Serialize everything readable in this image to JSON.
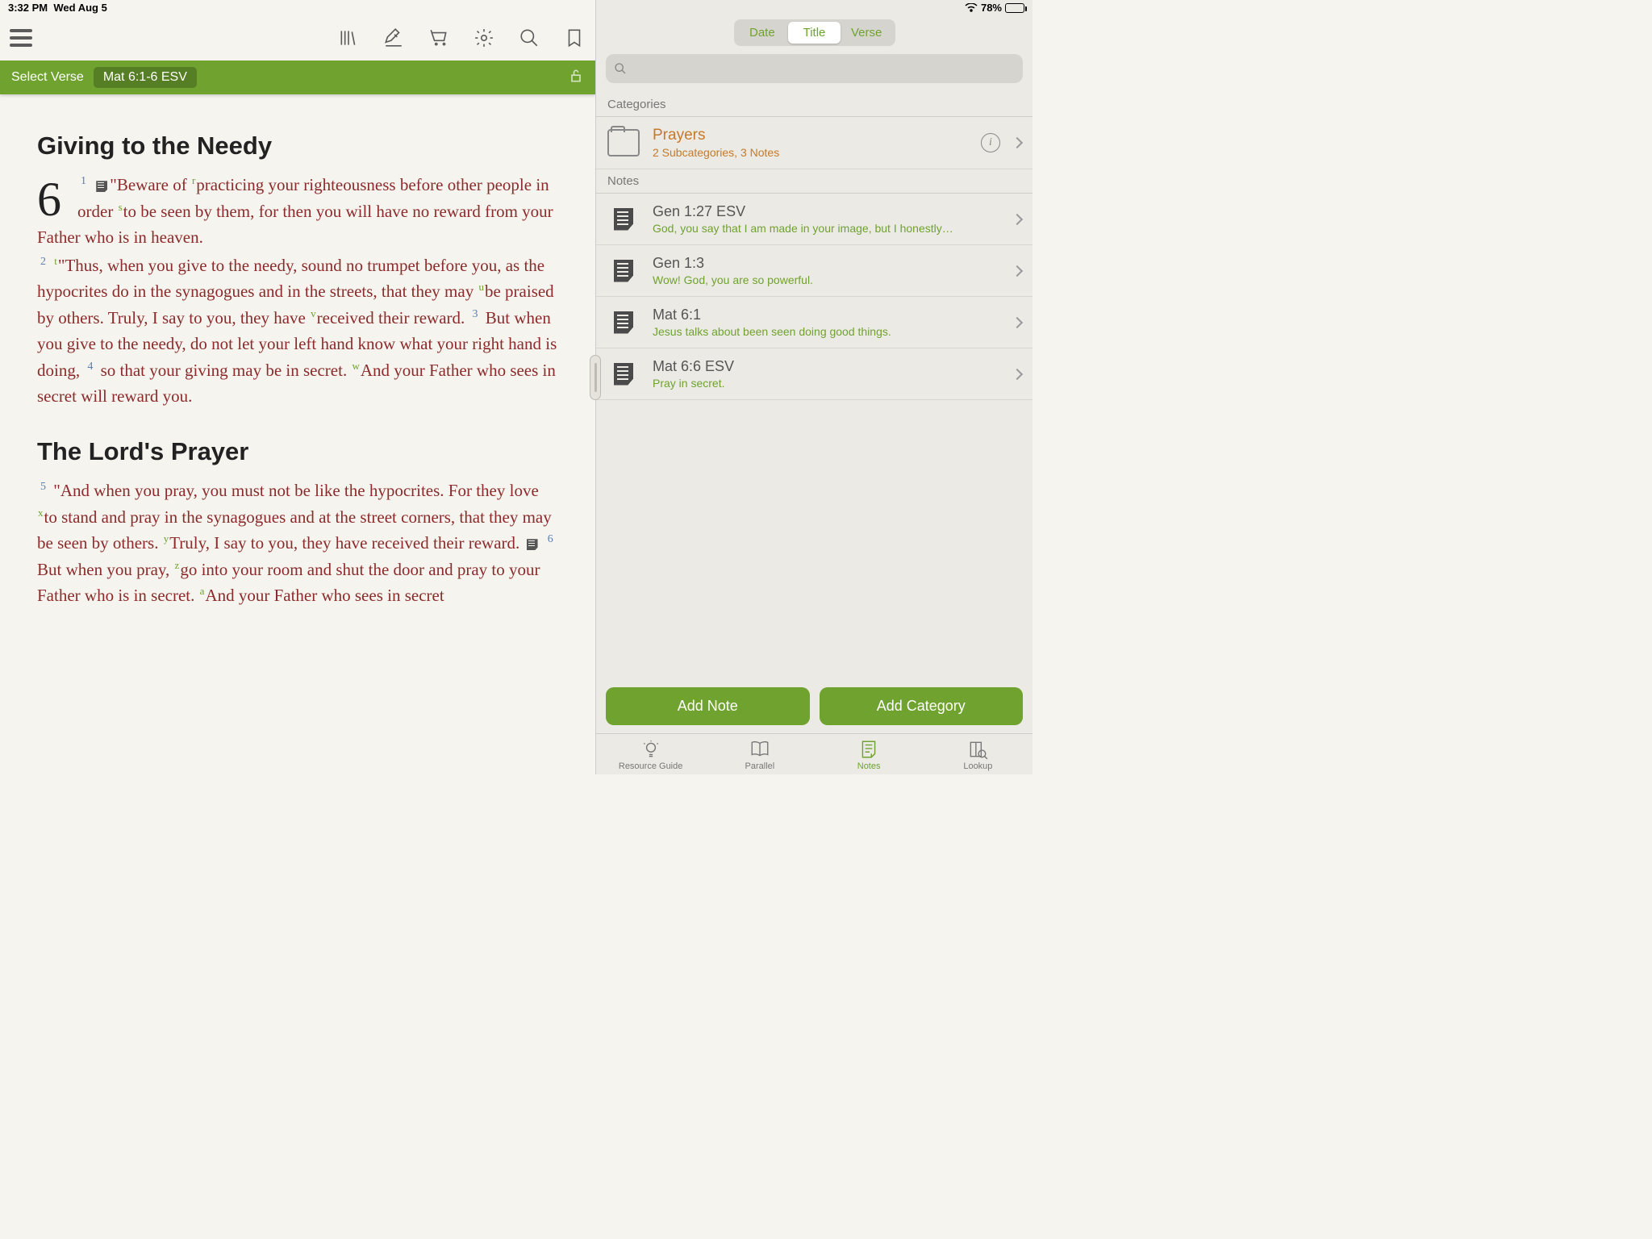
{
  "status": {
    "time": "3:32 PM",
    "date": "Wed Aug 5",
    "battery": "78%"
  },
  "toolbar": {
    "select_verse": "Select Verse",
    "verse_ref": "Mat 6:1-6 ESV"
  },
  "reader": {
    "heading1": "Giving to the Needy",
    "chapter": "6",
    "heading2": "The Lord's Prayer",
    "v1a": "\"Beware of ",
    "v1b": "practicing your righteousness before other people in order ",
    "v1c": "to be seen by them, for then you will have no reward from your Father who is in heaven.",
    "v2a": "\"Thus, when you give to the needy, sound no trumpet before you, as the hypocrites do in the syna­gogues and in the streets, that they may ",
    "v2b": "be praised by others. Truly, I say to you, they have ",
    "v2c": "received their reward. ",
    "v3": " But when you give to the needy, do not let your left hand know what your right hand is doing, ",
    "v4a": " so that your giving may be in secret. ",
    "v4b": "And your Fa­ther who sees in secret will reward you.",
    "v5a": " \"And when you pray, you must not be like the hypocrites. For they love ",
    "v5b": "to stand and pray in the synagogues and at the street corners, that they may be seen by others. ",
    "v5c": "Truly, I say to you, they have re­ceived their reward. ",
    "v6a": " But when you pray, ",
    "v6b": "go into your room and shut the door and pray to your Father who is in secret. ",
    "v6c": "And your Father who sees in secret"
  },
  "segmented": {
    "date": "Date",
    "title": "Title",
    "verse": "Verse"
  },
  "sections": {
    "categories": "Categories",
    "notes": "Notes"
  },
  "category": {
    "name": "Prayers",
    "sub": "2 Subcategories, 3 Notes"
  },
  "notes": [
    {
      "title": "Gen 1:27 ESV",
      "sub": "God, you say that I am made in your image, but I honestly…"
    },
    {
      "title": "Gen 1:3",
      "sub": "Wow! God, you are so powerful."
    },
    {
      "title": "Mat 6:1",
      "sub": "Jesus talks about been seen doing good things."
    },
    {
      "title": "Mat 6:6 ESV",
      "sub": "Pray in secret."
    }
  ],
  "actions": {
    "add_note": "Add Note",
    "add_category": "Add Category"
  },
  "tabs": {
    "guide": "Resource Guide",
    "parallel": "Parallel",
    "notes": "Notes",
    "lookup": "Lookup"
  }
}
